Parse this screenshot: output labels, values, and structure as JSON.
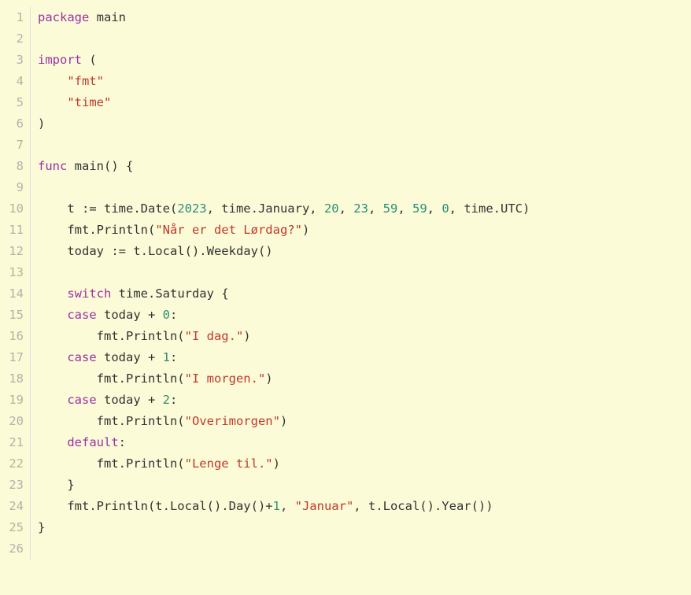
{
  "editor": {
    "language": "Go",
    "filename_hint": "main.go",
    "total_lines": 26,
    "background_color": "#fbfbd8",
    "gutter_number_color": "#b3b3a6",
    "gutter_rule_color": "#dededc",
    "colors": {
      "keyword": "#9b30a5",
      "string": "#c0392b",
      "number": "#2b8f73",
      "plain": "#333333"
    }
  },
  "lines": [
    {
      "number": "1",
      "text": "package main",
      "tokens": [
        {
          "t": "package",
          "k": "keyword"
        },
        {
          "t": " main",
          "k": "plain"
        }
      ]
    },
    {
      "number": "2",
      "text": "",
      "tokens": []
    },
    {
      "number": "3",
      "text": "import (",
      "tokens": [
        {
          "t": "import",
          "k": "keyword"
        },
        {
          "t": " (",
          "k": "plain"
        }
      ]
    },
    {
      "number": "4",
      "text": "    \"fmt\"",
      "tokens": [
        {
          "t": "    ",
          "k": "plain"
        },
        {
          "t": "\"fmt\"",
          "k": "string"
        }
      ]
    },
    {
      "number": "5",
      "text": "    \"time\"",
      "tokens": [
        {
          "t": "    ",
          "k": "plain"
        },
        {
          "t": "\"time\"",
          "k": "string"
        }
      ]
    },
    {
      "number": "6",
      "text": ")",
      "tokens": [
        {
          "t": ")",
          "k": "plain"
        }
      ]
    },
    {
      "number": "7",
      "text": "",
      "tokens": []
    },
    {
      "number": "8",
      "text": "func main() {",
      "tokens": [
        {
          "t": "func",
          "k": "keyword"
        },
        {
          "t": " main() {",
          "k": "plain"
        }
      ]
    },
    {
      "number": "9",
      "text": "",
      "tokens": []
    },
    {
      "number": "10",
      "text": "    t := time.Date(2023, time.January, 20, 23, 59, 59, 0, time.UTC)",
      "tokens": [
        {
          "t": "    t := time.Date(",
          "k": "plain"
        },
        {
          "t": "2023",
          "k": "number"
        },
        {
          "t": ", time.January, ",
          "k": "plain"
        },
        {
          "t": "20",
          "k": "number"
        },
        {
          "t": ", ",
          "k": "plain"
        },
        {
          "t": "23",
          "k": "number"
        },
        {
          "t": ", ",
          "k": "plain"
        },
        {
          "t": "59",
          "k": "number"
        },
        {
          "t": ", ",
          "k": "plain"
        },
        {
          "t": "59",
          "k": "number"
        },
        {
          "t": ", ",
          "k": "plain"
        },
        {
          "t": "0",
          "k": "number"
        },
        {
          "t": ", time.UTC)",
          "k": "plain"
        }
      ]
    },
    {
      "number": "11",
      "text": "    fmt.Println(\"Når er det Lørdag?\")",
      "tokens": [
        {
          "t": "    fmt.Println(",
          "k": "plain"
        },
        {
          "t": "\"Når er det Lørdag?\"",
          "k": "string"
        },
        {
          "t": ")",
          "k": "plain"
        }
      ]
    },
    {
      "number": "12",
      "text": "    today := t.Local().Weekday()",
      "tokens": [
        {
          "t": "    today := t.Local().Weekday()",
          "k": "plain"
        }
      ]
    },
    {
      "number": "13",
      "text": "",
      "tokens": []
    },
    {
      "number": "14",
      "text": "    switch time.Saturday {",
      "tokens": [
        {
          "t": "    ",
          "k": "plain"
        },
        {
          "t": "switch",
          "k": "keyword"
        },
        {
          "t": " time.Saturday {",
          "k": "plain"
        }
      ]
    },
    {
      "number": "15",
      "text": "    case today + 0:",
      "tokens": [
        {
          "t": "    ",
          "k": "plain"
        },
        {
          "t": "case",
          "k": "keyword"
        },
        {
          "t": " today + ",
          "k": "plain"
        },
        {
          "t": "0",
          "k": "number"
        },
        {
          "t": ":",
          "k": "plain"
        }
      ]
    },
    {
      "number": "16",
      "text": "        fmt.Println(\"I dag.\")",
      "tokens": [
        {
          "t": "        fmt.Println(",
          "k": "plain"
        },
        {
          "t": "\"I dag.\"",
          "k": "string"
        },
        {
          "t": ")",
          "k": "plain"
        }
      ]
    },
    {
      "number": "17",
      "text": "    case today + 1:",
      "tokens": [
        {
          "t": "    ",
          "k": "plain"
        },
        {
          "t": "case",
          "k": "keyword"
        },
        {
          "t": " today + ",
          "k": "plain"
        },
        {
          "t": "1",
          "k": "number"
        },
        {
          "t": ":",
          "k": "plain"
        }
      ]
    },
    {
      "number": "18",
      "text": "        fmt.Println(\"I morgen.\")",
      "tokens": [
        {
          "t": "        fmt.Println(",
          "k": "plain"
        },
        {
          "t": "\"I morgen.\"",
          "k": "string"
        },
        {
          "t": ")",
          "k": "plain"
        }
      ]
    },
    {
      "number": "19",
      "text": "    case today + 2:",
      "tokens": [
        {
          "t": "    ",
          "k": "plain"
        },
        {
          "t": "case",
          "k": "keyword"
        },
        {
          "t": " today + ",
          "k": "plain"
        },
        {
          "t": "2",
          "k": "number"
        },
        {
          "t": ":",
          "k": "plain"
        }
      ]
    },
    {
      "number": "20",
      "text": "        fmt.Println(\"Overimorgen\")",
      "tokens": [
        {
          "t": "        fmt.Println(",
          "k": "plain"
        },
        {
          "t": "\"Overimorgen\"",
          "k": "string"
        },
        {
          "t": ")",
          "k": "plain"
        }
      ]
    },
    {
      "number": "21",
      "text": "    default:",
      "tokens": [
        {
          "t": "    ",
          "k": "plain"
        },
        {
          "t": "default",
          "k": "keyword"
        },
        {
          "t": ":",
          "k": "plain"
        }
      ]
    },
    {
      "number": "22",
      "text": "        fmt.Println(\"Lenge til.\")",
      "tokens": [
        {
          "t": "        fmt.Println(",
          "k": "plain"
        },
        {
          "t": "\"Lenge til.\"",
          "k": "string"
        },
        {
          "t": ")",
          "k": "plain"
        }
      ]
    },
    {
      "number": "23",
      "text": "    }",
      "tokens": [
        {
          "t": "    }",
          "k": "plain"
        }
      ]
    },
    {
      "number": "24",
      "text": "    fmt.Println(t.Local().Day()+1, \"Januar\", t.Local().Year())",
      "tokens": [
        {
          "t": "    fmt.Println(t.Local().Day()+",
          "k": "plain"
        },
        {
          "t": "1",
          "k": "number"
        },
        {
          "t": ", ",
          "k": "plain"
        },
        {
          "t": "\"Januar\"",
          "k": "string"
        },
        {
          "t": ", t.Local().Year())",
          "k": "plain"
        }
      ]
    },
    {
      "number": "25",
      "text": "}",
      "tokens": [
        {
          "t": "}",
          "k": "plain"
        }
      ]
    },
    {
      "number": "26",
      "text": "",
      "tokens": []
    }
  ]
}
